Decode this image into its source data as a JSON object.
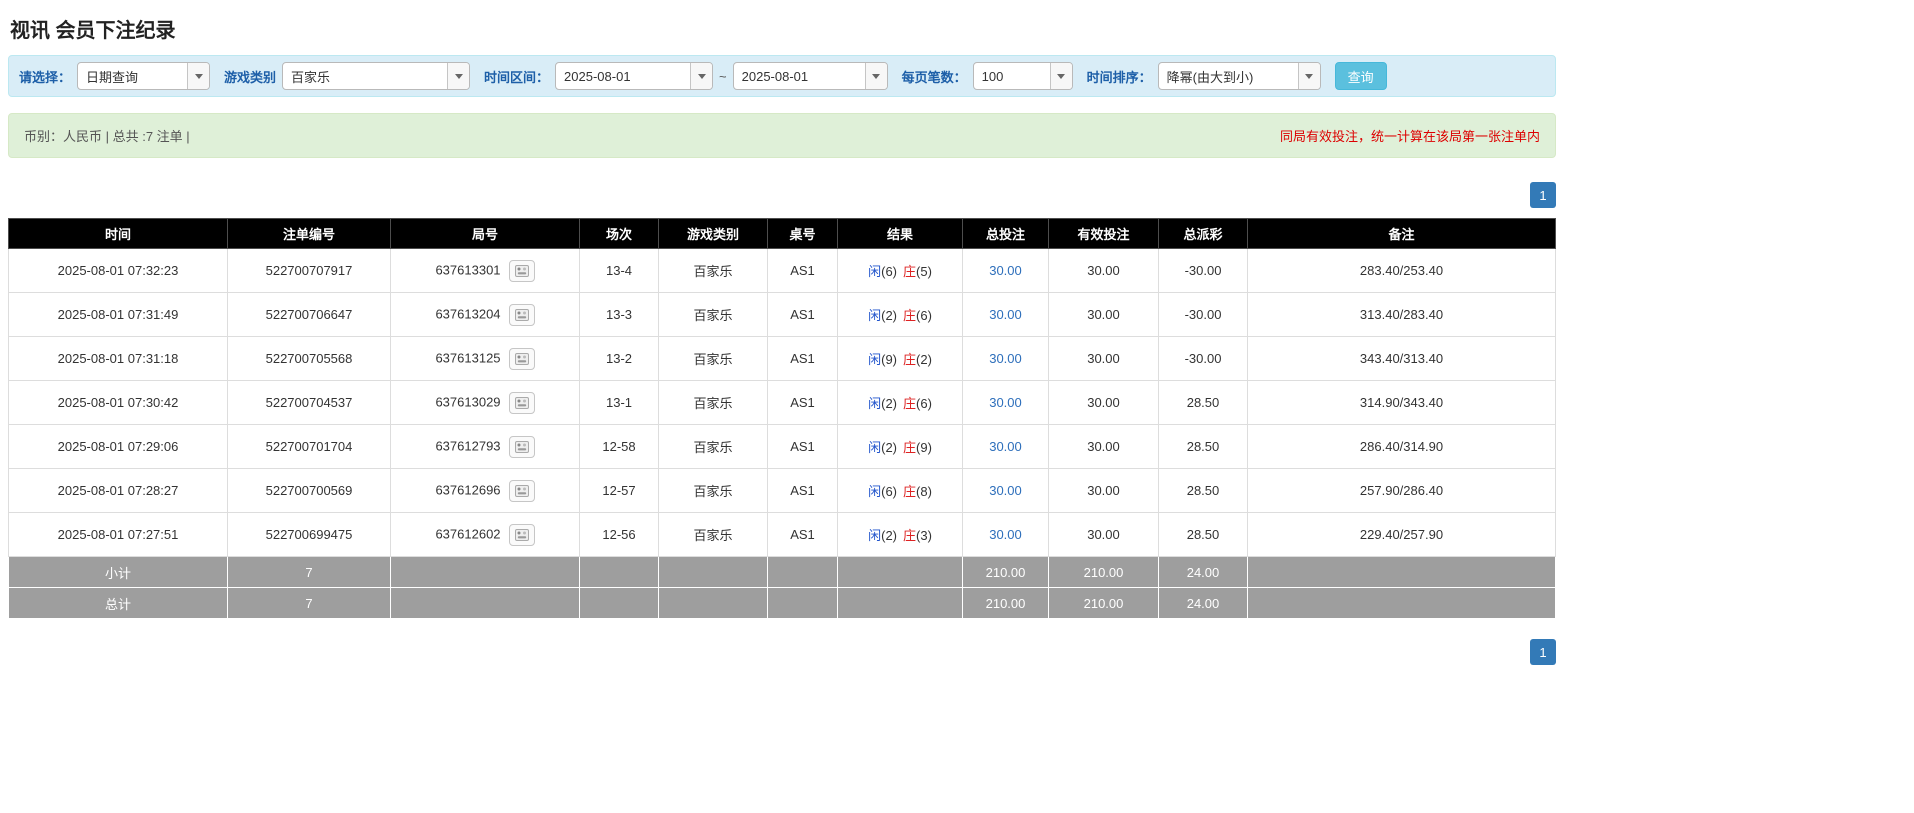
{
  "page": {
    "title": "视讯 会员下注纪录"
  },
  "filters": {
    "select_label": "请选择：",
    "select_value": "日期查询",
    "game_type_label": "游戏类别",
    "game_type_value": "百家乐",
    "time_range_label": "时间区间：",
    "time_from": "2025-08-01",
    "tilde": "~",
    "time_to": "2025-08-01",
    "page_size_label": "每页笔数：",
    "page_size_value": "100",
    "sort_label": "时间排序：",
    "sort_value": "降幂(由大到小)",
    "search_button": "查询"
  },
  "summary": {
    "left": "币别：人民币 | 总共 :7 注单 |",
    "right_notice": "同局有效投注，统一计算在该局第一张注单内"
  },
  "pagination": {
    "page": "1"
  },
  "table": {
    "headers": [
      "时间",
      "注单编号",
      "局号",
      "场次",
      "游戏类别",
      "桌号",
      "结果",
      "总投注",
      "有效投注",
      "总派彩",
      "备注"
    ],
    "rows": [
      {
        "time": "2025-08-01 07:32:23",
        "bet_id": "522700707917",
        "round_id": "637613301",
        "session": "13-4",
        "game": "百家乐",
        "table_no": "AS1",
        "player_label": "闲",
        "player_score": "(6)",
        "banker_label": "庄",
        "banker_score": "(5)",
        "total_bet": "30.00",
        "valid_bet": "30.00",
        "payout": "-30.00",
        "remark": "283.40/253.40"
      },
      {
        "time": "2025-08-01 07:31:49",
        "bet_id": "522700706647",
        "round_id": "637613204",
        "session": "13-3",
        "game": "百家乐",
        "table_no": "AS1",
        "player_label": "闲",
        "player_score": "(2)",
        "banker_label": "庄",
        "banker_score": "(6)",
        "total_bet": "30.00",
        "valid_bet": "30.00",
        "payout": "-30.00",
        "remark": "313.40/283.40"
      },
      {
        "time": "2025-08-01 07:31:18",
        "bet_id": "522700705568",
        "round_id": "637613125",
        "session": "13-2",
        "game": "百家乐",
        "table_no": "AS1",
        "player_label": "闲",
        "player_score": "(9)",
        "banker_label": "庄",
        "banker_score": "(2)",
        "total_bet": "30.00",
        "valid_bet": "30.00",
        "payout": "-30.00",
        "remark": "343.40/313.40"
      },
      {
        "time": "2025-08-01 07:30:42",
        "bet_id": "522700704537",
        "round_id": "637613029",
        "session": "13-1",
        "game": "百家乐",
        "table_no": "AS1",
        "player_label": "闲",
        "player_score": "(2)",
        "banker_label": "庄",
        "banker_score": "(6)",
        "total_bet": "30.00",
        "valid_bet": "30.00",
        "payout": "28.50",
        "remark": "314.90/343.40"
      },
      {
        "time": "2025-08-01 07:29:06",
        "bet_id": "522700701704",
        "round_id": "637612793",
        "session": "12-58",
        "game": "百家乐",
        "table_no": "AS1",
        "player_label": "闲",
        "player_score": "(2)",
        "banker_label": "庄",
        "banker_score": "(9)",
        "total_bet": "30.00",
        "valid_bet": "30.00",
        "payout": "28.50",
        "remark": "286.40/314.90"
      },
      {
        "time": "2025-08-01 07:28:27",
        "bet_id": "522700700569",
        "round_id": "637612696",
        "session": "12-57",
        "game": "百家乐",
        "table_no": "AS1",
        "player_label": "闲",
        "player_score": "(6)",
        "banker_label": "庄",
        "banker_score": "(8)",
        "total_bet": "30.00",
        "valid_bet": "30.00",
        "payout": "28.50",
        "remark": "257.90/286.40"
      },
      {
        "time": "2025-08-01 07:27:51",
        "bet_id": "522700699475",
        "round_id": "637612602",
        "session": "12-56",
        "game": "百家乐",
        "table_no": "AS1",
        "player_label": "闲",
        "player_score": "(2)",
        "banker_label": "庄",
        "banker_score": "(3)",
        "total_bet": "30.00",
        "valid_bet": "30.00",
        "payout": "28.50",
        "remark": "229.40/257.90"
      }
    ],
    "subtotal": {
      "label": "小计",
      "count": "7",
      "total_bet": "210.00",
      "valid_bet": "210.00",
      "payout": "24.00"
    },
    "total": {
      "label": "总计",
      "count": "7",
      "total_bet": "210.00",
      "valid_bet": "210.00",
      "payout": "24.00"
    }
  },
  "colors": {
    "filter_bg": "#d9edf7",
    "filter_border": "#bce8f1",
    "filter_label": "#1d5fa8",
    "button_bg": "#5bc0de",
    "button_border": "#46b8da",
    "summary_bg": "#dff0d8",
    "summary_border": "#d6e9c6",
    "summary_text": "#555555",
    "notice_red": "#dd0000",
    "header_bg": "#000000",
    "footer_bg": "#9e9e9e",
    "link_blue": "#2e6fbb",
    "player_blue": "#2255cc",
    "banker_red": "#dd2222",
    "negative_red": "#dd0000",
    "pagination_bg": "#337ab7"
  }
}
